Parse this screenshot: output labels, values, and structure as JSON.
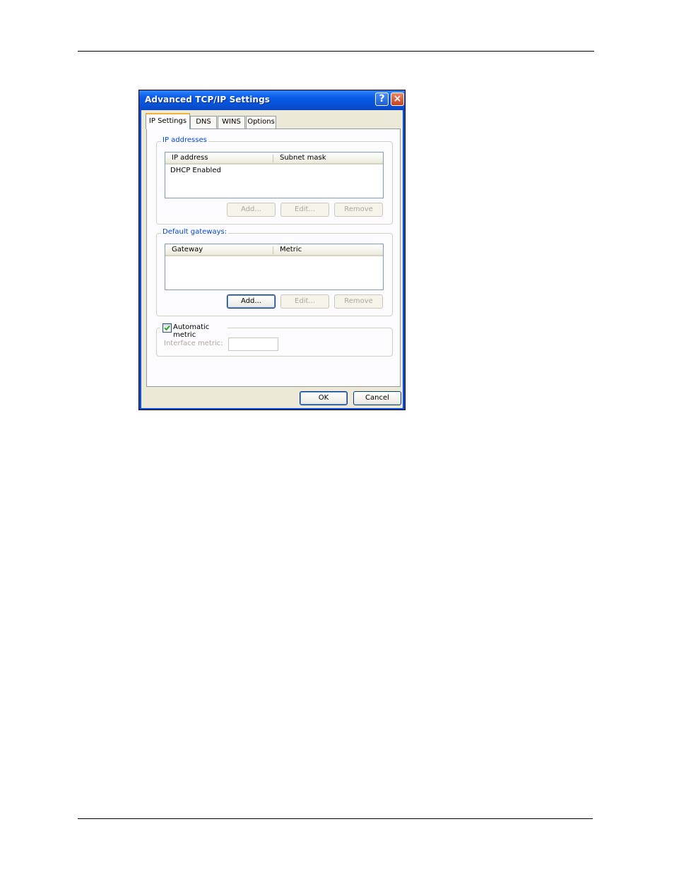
{
  "window": {
    "title": "Advanced TCP/IP Settings",
    "help_button": "?",
    "close_button": "×"
  },
  "tabs": [
    {
      "label": "IP Settings",
      "active": true
    },
    {
      "label": "DNS",
      "active": false
    },
    {
      "label": "WINS",
      "active": false
    },
    {
      "label": "Options",
      "active": false
    }
  ],
  "ip_addresses": {
    "legend": "IP addresses",
    "columns": [
      "IP address",
      "Subnet mask"
    ],
    "rows": [
      [
        "DHCP Enabled",
        ""
      ]
    ],
    "buttons": {
      "add": "Add...",
      "edit": "Edit...",
      "remove": "Remove"
    }
  },
  "default_gateways": {
    "legend": "Default gateways:",
    "columns": [
      "Gateway",
      "Metric"
    ],
    "rows": [],
    "buttons": {
      "add": "Add...",
      "edit": "Edit...",
      "remove": "Remove"
    }
  },
  "metric": {
    "automatic_label": "Automatic metric",
    "automatic_checked": true,
    "interface_label": "Interface metric:",
    "interface_value": ""
  },
  "footer": {
    "ok": "OK",
    "cancel": "Cancel"
  },
  "colors": {
    "titlebar": "#0752d9",
    "face": "#ece9d8",
    "legend_text": "#0046d5",
    "tab_highlight": "#f2b23a"
  }
}
